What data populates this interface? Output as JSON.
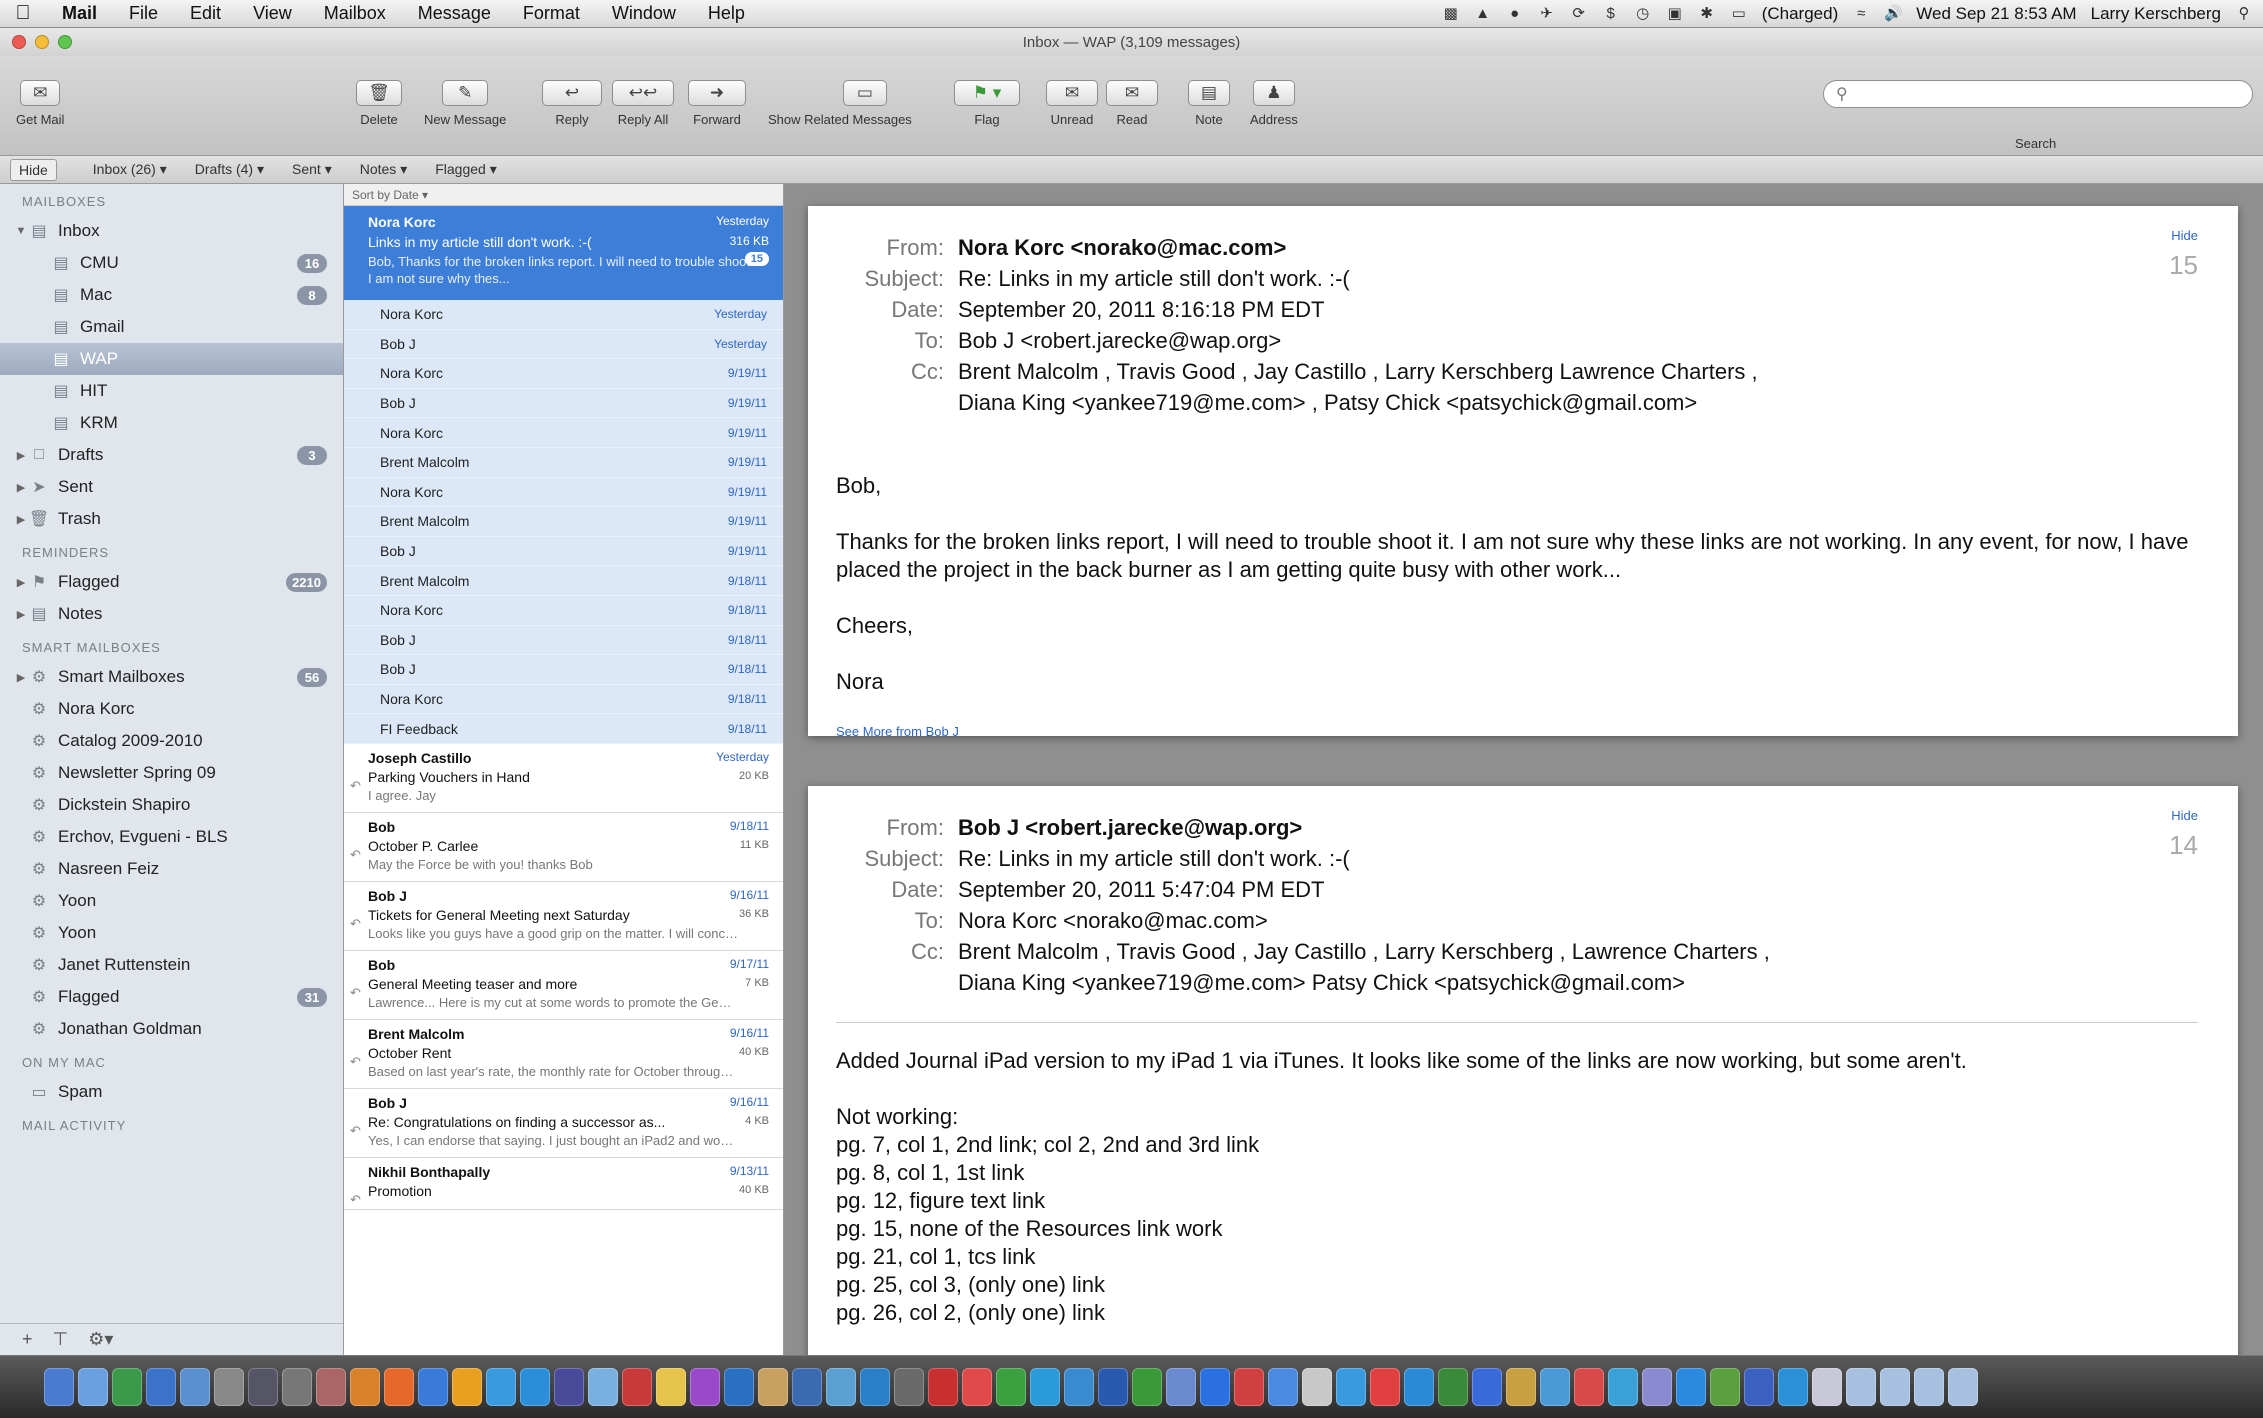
{
  "menubar": {
    "apple": "",
    "items": [
      "Mail",
      "File",
      "Edit",
      "View",
      "Mailbox",
      "Message",
      "Format",
      "Window",
      "Help"
    ],
    "battery": "(Charged)",
    "datetime": "Wed Sep 21  8:53 AM",
    "user": "Larry Kerschberg"
  },
  "window": {
    "title": "Inbox — WAP (3,109 messages)"
  },
  "toolbar": {
    "get_mail": "Get Mail",
    "delete": "Delete",
    "new_message": "New Message",
    "reply": "Reply",
    "reply_all": "Reply All",
    "forward": "Forward",
    "show_related": "Show Related Messages",
    "flag": "Flag",
    "unread": "Unread",
    "read": "Read",
    "note": "Note",
    "address": "Address",
    "search_label": "Search",
    "search_placeholder": ""
  },
  "favorites": {
    "hide": "Hide",
    "items": [
      "Inbox (26) ▾",
      "Drafts (4) ▾",
      "Sent ▾",
      "Notes ▾",
      "Flagged ▾"
    ]
  },
  "sidebar": {
    "sections": {
      "mailboxes": "MAILBOXES",
      "reminders": "REMINDERS",
      "smart": "SMART MAILBOXES",
      "on_my_mac": "ON MY MAC",
      "activity": "MAIL ACTIVITY"
    },
    "mailboxes": [
      {
        "label": "Inbox",
        "badge": ""
      },
      {
        "label": "CMU",
        "badge": "16"
      },
      {
        "label": "Mac",
        "badge": "8"
      },
      {
        "label": "Gmail",
        "badge": ""
      },
      {
        "label": "WAP",
        "badge": ""
      },
      {
        "label": "HIT",
        "badge": ""
      },
      {
        "label": "KRM",
        "badge": ""
      },
      {
        "label": "Drafts",
        "badge": "3"
      },
      {
        "label": "Sent",
        "badge": ""
      },
      {
        "label": "Trash",
        "badge": ""
      }
    ],
    "reminders": [
      {
        "label": "Flagged",
        "badge": "2210"
      },
      {
        "label": "Notes",
        "badge": ""
      }
    ],
    "smart": [
      {
        "label": "Smart Mailboxes",
        "badge": "56"
      },
      {
        "label": "Nora Korc",
        "badge": ""
      },
      {
        "label": "Catalog 2009-2010",
        "badge": ""
      },
      {
        "label": "Newsletter Spring 09",
        "badge": ""
      },
      {
        "label": "Dickstein Shapiro",
        "badge": ""
      },
      {
        "label": "Erchov, Evgueni - BLS",
        "badge": ""
      },
      {
        "label": "Nasreen Feiz",
        "badge": ""
      },
      {
        "label": "Yoon",
        "badge": ""
      },
      {
        "label": "Yoon",
        "badge": ""
      },
      {
        "label": "Janet Ruttenstein",
        "badge": ""
      },
      {
        "label": "Flagged",
        "badge": "31"
      },
      {
        "label": "Jonathan Goldman",
        "badge": ""
      }
    ],
    "on_my_mac": [
      {
        "label": "Spam",
        "badge": ""
      }
    ],
    "footer": {
      "add": "+",
      "filter": "⊤",
      "gear": "⚙▾"
    }
  },
  "message_list": {
    "sort": "Sort by Date ▾",
    "thread": {
      "from": "Nora Korc",
      "date": "Yesterday",
      "subject": "Links in my article still don't work. :-(",
      "size": "316 KB",
      "count": "15",
      "preview": "Bob, Thanks for the broken links report. I will need to trouble shoot it. I am not sure why thes..."
    },
    "thread_rows": [
      {
        "from": "Nora Korc",
        "date": "Yesterday"
      },
      {
        "from": "Bob J",
        "date": "Yesterday"
      },
      {
        "from": "Nora Korc",
        "date": "9/19/11"
      },
      {
        "from": "Bob J",
        "date": "9/19/11"
      },
      {
        "from": "Nora Korc",
        "date": "9/19/11"
      },
      {
        "from": "Brent Malcolm",
        "date": "9/19/11"
      },
      {
        "from": "Nora Korc",
        "date": "9/19/11"
      },
      {
        "from": "Brent Malcolm",
        "date": "9/19/11"
      },
      {
        "from": "Bob J",
        "date": "9/19/11"
      },
      {
        "from": "Brent Malcolm",
        "date": "9/18/11"
      },
      {
        "from": "Nora Korc",
        "date": "9/18/11"
      },
      {
        "from": "Bob J",
        "date": "9/18/11"
      },
      {
        "from": "Bob J",
        "date": "9/18/11"
      },
      {
        "from": "Nora Korc",
        "date": "9/18/11"
      },
      {
        "from": "FI Feedback",
        "date": "9/18/11"
      }
    ],
    "messages": [
      {
        "from": "Joseph Castillo",
        "date": "Yesterday",
        "subject": "Parking Vouchers in Hand",
        "size": "20 KB",
        "preview": "I agree. Jay"
      },
      {
        "from": "Bob",
        "date": "9/18/11",
        "subject": "October P. Carlee",
        "size": "11 KB",
        "preview": "May the Force be with you! thanks Bob"
      },
      {
        "from": "Bob J",
        "date": "9/16/11",
        "subject": "Tickets for General Meeting next Saturday",
        "size": "36 KB",
        "preview": "Looks like you guys have a good grip on the matter. I will concentrate on my piece of the puz..."
      },
      {
        "from": "Bob",
        "date": "9/17/11",
        "subject": "General Meeting teaser and more",
        "size": "7 KB",
        "preview": "Lawrence... Here is my cut at some words to promote the General Meeting tease video. Want to know wh..."
      },
      {
        "from": "Brent Malcolm",
        "date": "9/16/11",
        "subject": "October Rent",
        "size": "40 KB",
        "preview": "Based on last year's rate, the monthly rate for October through December will be $1,201.95. S..."
      },
      {
        "from": "Bob J",
        "date": "9/16/11",
        "subject": "Re: Congratulations on finding a successor as...",
        "size": "4 KB",
        "preview": "Yes, I can endorse that saying. I just bought an iPad2 and wonder what learning courses are. Does WAP..."
      },
      {
        "from": "Nikhil Bonthapally",
        "date": "9/13/11",
        "subject": "Promotion",
        "size": "40 KB",
        "preview": ""
      }
    ]
  },
  "reader": {
    "labels": {
      "from": "From:",
      "subject": "Subject:",
      "date": "Date:",
      "to": "To:",
      "cc": "Cc:",
      "hide": "Hide"
    },
    "msg1": {
      "from": "Nora Korc <norako@mac.com>",
      "subject": "Re: Links in my article still don't work. :-(",
      "date": "September 20, 2011 8:16:18 PM EDT",
      "to": "Bob J <robert.jarecke@wap.org>",
      "cc1": "Brent Malcolm , Travis Good , Jay Castillo , Larry Kerschberg   Lawrence Charters ,",
      "cc2": "Diana King <yankee719@me.com> , Patsy Chick <patsychick@gmail.com>",
      "number": "15",
      "body_greeting": "Bob,",
      "body_main": "Thanks for the broken links report, I will need to trouble shoot it.  I am not sure why these links are not working.  In any event, for now, I have placed the project in the back burner as I am getting quite busy with other work...",
      "body_closing": "Cheers,",
      "body_sig": "Nora",
      "see_more": "See More from Bob J"
    },
    "msg2": {
      "from": "Bob J <robert.jarecke@wap.org>",
      "subject": "Re: Links in my article still don't work. :-(",
      "date": "September 20, 2011 5:47:04 PM EDT",
      "to": "Nora Korc <norako@mac.com>",
      "cc1": "Brent Malcolm , Travis Good , Jay Castillo , Larry Kerschberg , Lawrence Charters ,",
      "cc2": "Diana King <yankee719@me.com>   Patsy Chick <patsychick@gmail.com>",
      "number": "14",
      "body_intro": "Added Journal iPad version to my iPad 1 via iTunes. It looks like some of the links are now working, but some aren't.",
      "body_nw": "Not working:",
      "lines": [
        "pg. 7, col 1, 2nd link; col 2, 2nd and 3rd link",
        "pg. 8, col 1, 1st link",
        "pg. 12, figure text link",
        "pg. 15, none of the Resources link work",
        "pg. 21, col 1, tcs link",
        "pg. 25, col 3, (only one) link",
        "pg. 26, col 2, (only one) link"
      ]
    }
  },
  "colors": {
    "selection_blue": "#3d7ed8",
    "thread_light": "#dce8f8",
    "sidebar_bg": "#e1e5ec",
    "badge_gray": "#8c95a6",
    "link_blue": "#2e66c2"
  }
}
